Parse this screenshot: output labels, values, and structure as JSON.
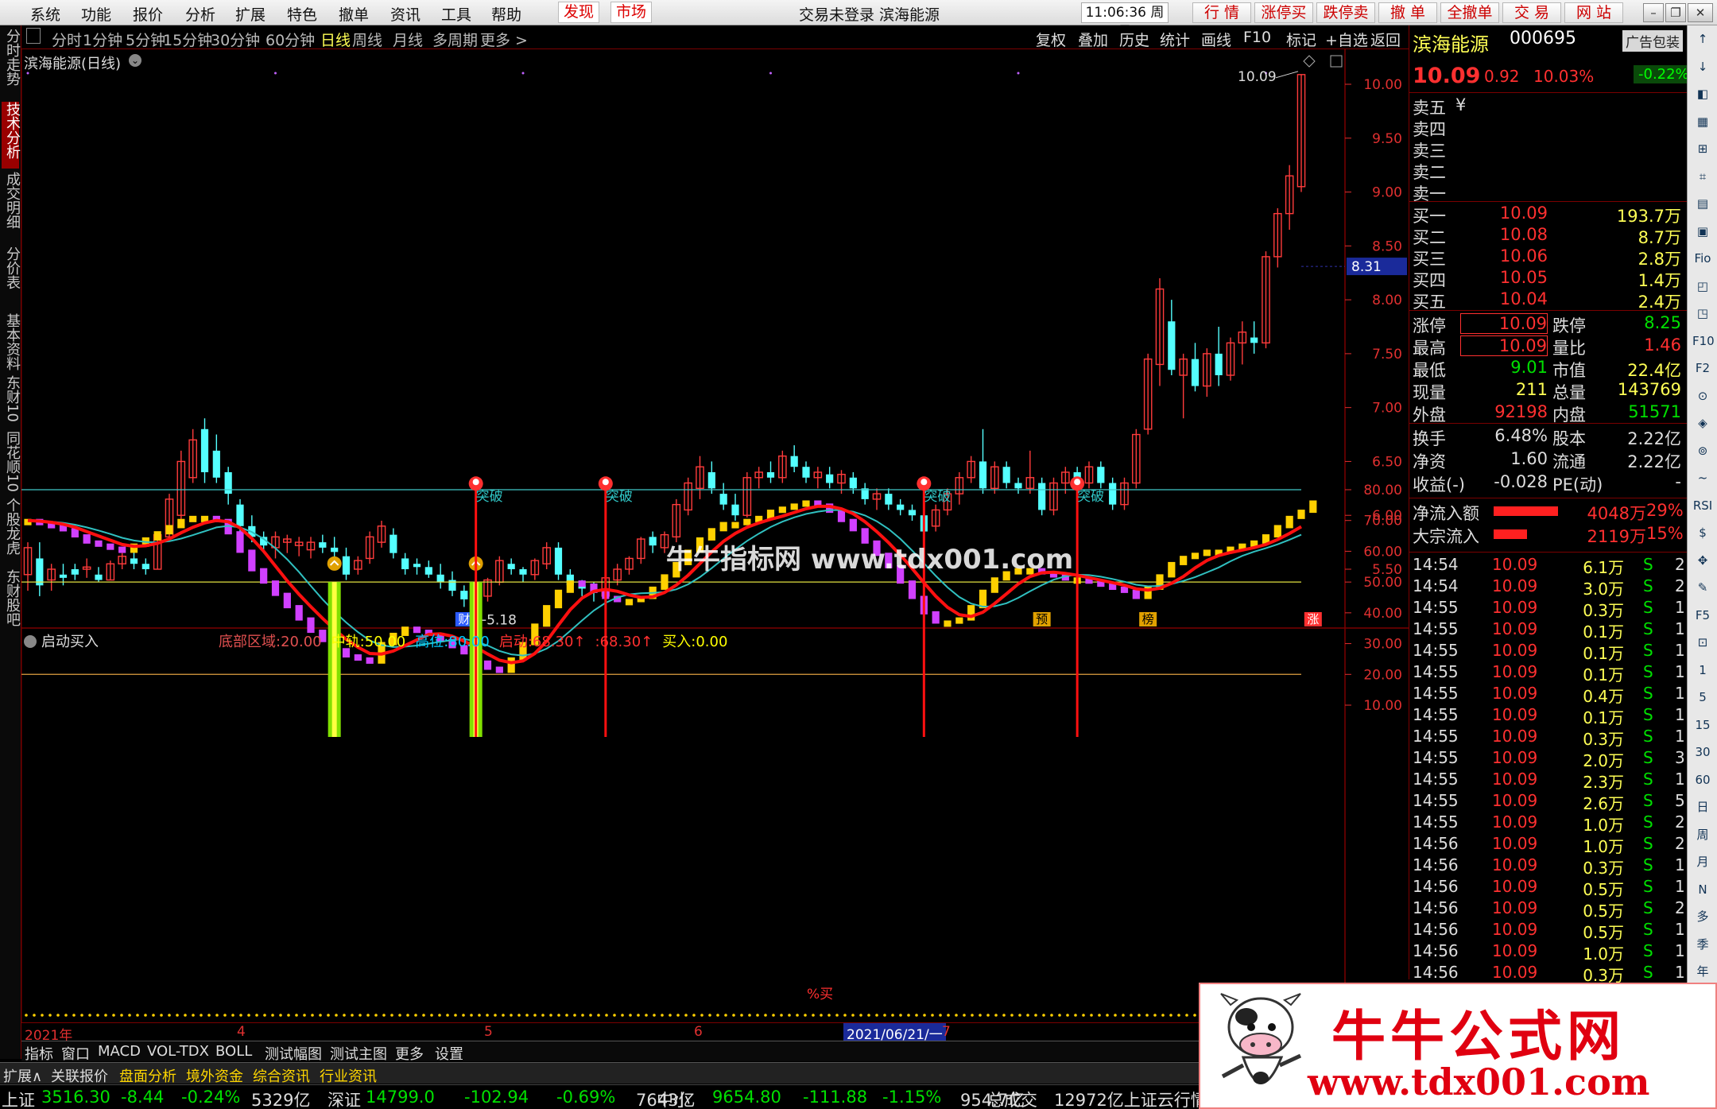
{
  "menu": {
    "items": [
      "系统",
      "功能",
      "报价",
      "分析",
      "扩展",
      "特色",
      "撤单",
      "资讯",
      "工具",
      "帮助"
    ],
    "discover": "发现",
    "market": "市场",
    "title": "交易未登录  滨海能源",
    "time": "11:06:36 周日",
    "quick": [
      "行 情",
      "涨停买",
      "跌停卖",
      "撤 单",
      "全撤单",
      "交 易",
      "网 站"
    ]
  },
  "left_tabs": [
    "分时走势",
    "技术分析",
    "成交明细",
    "分价表",
    "基本资料",
    "东财10",
    "同花顺10",
    "个股龙虎",
    "东财股吧"
  ],
  "period_bar": {
    "items": [
      "分时",
      "1分钟",
      "5分钟",
      "15分钟",
      "30分钟",
      "60分钟",
      "日线",
      "周线",
      "月线",
      "多周期",
      "更多 >"
    ],
    "selected": "日线",
    "tools": [
      "复权",
      "叠加",
      "历史",
      "统计",
      "画线",
      "F10",
      "标记",
      "+自选",
      "返回"
    ]
  },
  "main_chart": {
    "title": "滨海能源(日线)",
    "y_ticks": [
      "10.00",
      "9.50",
      "9.00",
      "8.50",
      "8.00",
      "7.50",
      "7.00",
      "6.50",
      "6.00",
      "5.50"
    ],
    "current_tag": "8.31",
    "high_label": "10.09",
    "low_label": "5.18",
    "markers": [
      "财",
      "预",
      "榜",
      "涨"
    ]
  },
  "watermark": "牛牛指标网  www.tdx001.com",
  "indicator": {
    "name": "启动买入",
    "params": [
      {
        "label": "底部区域:",
        "value": "20.00",
        "color": "#e05050"
      },
      {
        "label": "中轨:",
        "value": "50.00",
        "color": "#ffff00"
      },
      {
        "label": "高位:",
        "value": "80.00",
        "color": "#00c8ff"
      },
      {
        "label": "启动:",
        "value": "68.30↑",
        "color": "#ff3030"
      },
      {
        "label": ":",
        "value": "68.30↑",
        "color": "#ff3030"
      },
      {
        "label": "买入:",
        "value": "0.00",
        "color": "#ffff00"
      }
    ],
    "y_ticks": [
      "80.00",
      "70.00",
      "60.00",
      "50.00",
      "40.00",
      "30.00",
      "20.00",
      "10.00"
    ],
    "signal": "突破",
    "buy_text": "%买"
  },
  "chart_data": {
    "type": "candlestick",
    "title": "滨海能源(日线)",
    "ylim": [
      5.0,
      10.2
    ],
    "candles": [
      [
        5.45,
        5.75,
        5.3,
        5.7
      ],
      [
        5.6,
        5.75,
        5.25,
        5.35
      ],
      [
        5.4,
        5.55,
        5.3,
        5.5
      ],
      [
        5.45,
        5.55,
        5.35,
        5.42
      ],
      [
        5.5,
        5.55,
        5.4,
        5.45
      ],
      [
        5.5,
        5.6,
        5.42,
        5.52
      ],
      [
        5.45,
        5.52,
        5.38,
        5.4
      ],
      [
        5.4,
        5.58,
        5.4,
        5.55
      ],
      [
        5.55,
        5.65,
        5.5,
        5.62
      ],
      [
        5.6,
        5.72,
        5.5,
        5.55
      ],
      [
        5.55,
        5.6,
        5.45,
        5.5
      ],
      [
        5.5,
        5.85,
        5.5,
        5.82
      ],
      [
        5.8,
        6.2,
        5.8,
        6.15
      ],
      [
        6.0,
        6.6,
        5.9,
        6.5
      ],
      [
        6.35,
        6.8,
        6.3,
        6.7
      ],
      [
        6.8,
        6.9,
        6.3,
        6.4
      ],
      [
        6.6,
        6.75,
        6.3,
        6.35
      ],
      [
        6.4,
        6.45,
        6.1,
        6.2
      ],
      [
        6.1,
        6.15,
        5.85,
        5.9
      ],
      [
        5.9,
        6.0,
        5.75,
        5.8
      ],
      [
        5.8,
        5.85,
        5.65,
        5.72
      ],
      [
        5.7,
        5.85,
        5.6,
        5.8
      ],
      [
        5.75,
        5.82,
        5.65,
        5.78
      ],
      [
        5.72,
        5.8,
        5.62,
        5.75
      ],
      [
        5.68,
        5.8,
        5.6,
        5.75
      ],
      [
        5.75,
        5.82,
        5.65,
        5.7
      ],
      [
        5.7,
        5.8,
        5.6,
        5.66
      ],
      [
        5.62,
        5.7,
        5.4,
        5.45
      ],
      [
        5.5,
        5.62,
        5.45,
        5.58
      ],
      [
        5.6,
        5.85,
        5.55,
        5.8
      ],
      [
        5.75,
        5.95,
        5.7,
        5.9
      ],
      [
        5.82,
        5.88,
        5.6,
        5.65
      ],
      [
        5.6,
        5.65,
        5.45,
        5.5
      ],
      [
        5.55,
        5.6,
        5.45,
        5.52
      ],
      [
        5.52,
        5.58,
        5.42,
        5.45
      ],
      [
        5.45,
        5.55,
        5.32,
        5.38
      ],
      [
        5.4,
        5.48,
        5.25,
        5.3
      ],
      [
        5.3,
        5.35,
        5.15,
        5.22
      ],
      [
        5.2,
        5.3,
        5.12,
        5.25
      ],
      [
        5.25,
        5.42,
        5.2,
        5.4
      ],
      [
        5.38,
        5.62,
        5.35,
        5.58
      ],
      [
        5.55,
        5.6,
        5.45,
        5.5
      ],
      [
        5.5,
        5.52,
        5.38,
        5.45
      ],
      [
        5.45,
        5.6,
        5.4,
        5.58
      ],
      [
        5.55,
        5.75,
        5.5,
        5.7
      ],
      [
        5.7,
        5.75,
        5.4,
        5.45
      ],
      [
        5.45,
        5.5,
        5.3,
        5.35
      ],
      [
        5.35,
        5.4,
        5.25,
        5.32
      ],
      [
        5.3,
        5.38,
        5.2,
        5.28
      ],
      [
        5.25,
        5.45,
        5.22,
        5.42
      ],
      [
        5.4,
        5.55,
        5.35,
        5.5
      ],
      [
        5.5,
        5.62,
        5.45,
        5.6
      ],
      [
        5.6,
        5.8,
        5.55,
        5.78
      ],
      [
        5.8,
        5.85,
        5.65,
        5.72
      ],
      [
        5.7,
        5.85,
        5.65,
        5.82
      ],
      [
        5.8,
        6.15,
        5.75,
        6.1
      ],
      [
        6.05,
        6.35,
        6.0,
        6.3
      ],
      [
        6.25,
        6.55,
        6.15,
        6.45
      ],
      [
        6.4,
        6.5,
        6.2,
        6.25
      ],
      [
        6.2,
        6.3,
        6.05,
        6.1
      ],
      [
        6.1,
        6.2,
        5.95,
        6.0
      ],
      [
        6.0,
        6.4,
        5.98,
        6.35
      ],
      [
        6.35,
        6.45,
        6.25,
        6.4
      ],
      [
        6.4,
        6.5,
        6.3,
        6.35
      ],
      [
        6.35,
        6.6,
        6.3,
        6.55
      ],
      [
        6.55,
        6.65,
        6.4,
        6.45
      ],
      [
        6.45,
        6.5,
        6.3,
        6.35
      ],
      [
        6.35,
        6.45,
        6.25,
        6.4
      ],
      [
        6.38,
        6.45,
        6.25,
        6.3
      ],
      [
        6.3,
        6.42,
        6.2,
        6.38
      ],
      [
        6.35,
        6.4,
        6.2,
        6.25
      ],
      [
        6.25,
        6.3,
        6.1,
        6.15
      ],
      [
        6.15,
        6.25,
        6.05,
        6.2
      ],
      [
        6.2,
        6.25,
        6.05,
        6.1
      ],
      [
        6.1,
        6.15,
        6.0,
        6.05
      ],
      [
        6.05,
        6.1,
        5.95,
        6.0
      ],
      [
        6.0,
        6.05,
        5.75,
        5.85
      ],
      [
        5.9,
        6.1,
        5.85,
        6.05
      ],
      [
        6.05,
        6.25,
        6.0,
        6.2
      ],
      [
        6.2,
        6.4,
        6.1,
        6.35
      ],
      [
        6.35,
        6.55,
        6.3,
        6.5
      ],
      [
        6.5,
        6.8,
        6.2,
        6.25
      ],
      [
        6.25,
        6.5,
        6.2,
        6.45
      ],
      [
        6.45,
        6.5,
        6.25,
        6.3
      ],
      [
        6.3,
        6.35,
        6.2,
        6.25
      ],
      [
        6.25,
        6.6,
        6.2,
        6.35
      ],
      [
        6.3,
        6.35,
        6.0,
        6.05
      ],
      [
        6.05,
        6.35,
        6.0,
        6.3
      ],
      [
        6.3,
        6.45,
        6.2,
        6.4
      ],
      [
        6.4,
        6.45,
        6.25,
        6.3
      ],
      [
        6.3,
        6.5,
        6.25,
        6.45
      ],
      [
        6.45,
        6.5,
        6.25,
        6.3
      ],
      [
        6.3,
        6.35,
        6.05,
        6.1
      ],
      [
        6.1,
        6.35,
        6.05,
        6.3
      ],
      [
        6.3,
        6.8,
        6.25,
        6.75
      ],
      [
        6.8,
        7.5,
        6.75,
        7.45
      ],
      [
        7.4,
        8.2,
        7.2,
        8.1
      ],
      [
        7.8,
        8.0,
        7.3,
        7.35
      ],
      [
        7.3,
        7.5,
        6.9,
        7.45
      ],
      [
        7.45,
        7.6,
        7.15,
        7.2
      ],
      [
        7.2,
        7.55,
        7.1,
        7.5
      ],
      [
        7.5,
        7.75,
        7.2,
        7.3
      ],
      [
        7.3,
        7.65,
        7.25,
        7.6
      ],
      [
        7.6,
        7.8,
        7.4,
        7.7
      ],
      [
        7.65,
        7.8,
        7.5,
        7.6
      ],
      [
        7.6,
        8.45,
        7.55,
        8.4
      ],
      [
        8.4,
        8.85,
        8.3,
        8.8
      ],
      [
        8.8,
        9.25,
        8.65,
        9.15
      ],
      [
        9.05,
        10.09,
        9.0,
        10.09
      ]
    ],
    "indicator_series": {
      "ylim": [
        10,
        85
      ],
      "levels": [
        20,
        50,
        80
      ],
      "signals": [
        "突破",
        "突破",
        "突破",
        "突破"
      ]
    }
  },
  "quote": {
    "name": "滨海能源",
    "code": "000695",
    "ad": "广告包装",
    "price": "10.09",
    "change": "0.92",
    "pct": "10.03%",
    "pct2": "-0.22%",
    "asks": [
      {
        "label": "卖五",
        "price": "",
        "vol": ""
      },
      {
        "label": "卖四",
        "price": "",
        "vol": ""
      },
      {
        "label": "卖三",
        "price": "",
        "vol": ""
      },
      {
        "label": "卖二",
        "price": "",
        "vol": ""
      },
      {
        "label": "卖一",
        "price": "",
        "vol": ""
      }
    ],
    "bids": [
      {
        "label": "买一",
        "price": "10.09",
        "vol": "193.7万"
      },
      {
        "label": "买二",
        "price": "10.08",
        "vol": "8.7万"
      },
      {
        "label": "买三",
        "price": "10.06",
        "vol": "2.8万"
      },
      {
        "label": "买四",
        "price": "10.05",
        "vol": "1.4万"
      },
      {
        "label": "买五",
        "price": "10.04",
        "vol": "2.4万"
      }
    ],
    "stats": [
      [
        "涨停",
        "10.09",
        "跌停",
        "8.25"
      ],
      [
        "最高",
        "10.09",
        "量比",
        "1.46"
      ],
      [
        "最低",
        "9.01",
        "市值",
        "22.4亿"
      ],
      [
        "现量",
        "211",
        "总量",
        "143769"
      ],
      [
        "外盘",
        "92198",
        "内盘",
        "51571"
      ]
    ],
    "stats2": [
      [
        "换手",
        "6.48%",
        "股本",
        "2.22亿"
      ],
      [
        "净资",
        "1.60",
        "流通",
        "2.22亿"
      ],
      [
        "收益(-)",
        "-0.028",
        "PE(动)",
        "-"
      ]
    ],
    "flows": [
      {
        "label": "净流入额",
        "value": "4048万",
        "pct": "29%",
        "bar": 0.29
      },
      {
        "label": "大宗流入",
        "value": "2119万",
        "pct": "15%",
        "bar": 0.15
      }
    ],
    "ticks": [
      [
        "14:54",
        "10.09",
        "6.1万",
        "S",
        "2"
      ],
      [
        "14:54",
        "10.09",
        "3.0万",
        "S",
        "2"
      ],
      [
        "14:55",
        "10.09",
        "0.3万",
        "S",
        "1"
      ],
      [
        "14:55",
        "10.09",
        "0.1万",
        "S",
        "1"
      ],
      [
        "14:55",
        "10.09",
        "0.1万",
        "S",
        "1"
      ],
      [
        "14:55",
        "10.09",
        "0.1万",
        "S",
        "1"
      ],
      [
        "14:55",
        "10.09",
        "0.4万",
        "S",
        "1"
      ],
      [
        "14:55",
        "10.09",
        "0.1万",
        "S",
        "1"
      ],
      [
        "14:55",
        "10.09",
        "0.3万",
        "S",
        "1"
      ],
      [
        "14:55",
        "10.09",
        "2.0万",
        "S",
        "3"
      ],
      [
        "14:55",
        "10.09",
        "2.3万",
        "S",
        "1"
      ],
      [
        "14:55",
        "10.09",
        "2.6万",
        "S",
        "5"
      ],
      [
        "14:55",
        "10.09",
        "1.0万",
        "S",
        "2"
      ],
      [
        "14:56",
        "10.09",
        "1.0万",
        "S",
        "2"
      ],
      [
        "14:56",
        "10.09",
        "0.3万",
        "S",
        "1"
      ],
      [
        "14:56",
        "10.09",
        "0.5万",
        "S",
        "1"
      ],
      [
        "14:56",
        "10.09",
        "0.5万",
        "S",
        "2"
      ],
      [
        "14:56",
        "10.09",
        "0.5万",
        "S",
        "1"
      ],
      [
        "14:56",
        "10.09",
        "1.0万",
        "S",
        "1"
      ],
      [
        "14:56",
        "10.09",
        "0.3万",
        "S",
        "1"
      ]
    ]
  },
  "date_bar": {
    "start": "2021年",
    "m4": "4",
    "m5": "5",
    "m6": "6",
    "m7": "7",
    "cursor": "2021/06/21/一"
  },
  "bottom_tabs": [
    "指标",
    "窗口",
    "MACD",
    "VOL-TDX",
    "BOLL",
    "测试幅图",
    "测试主图",
    "更多",
    "设置"
  ],
  "function_tabs": [
    {
      "label": "扩展∧",
      "color": "#ddd"
    },
    {
      "label": "关联报价",
      "color": "#ddd"
    },
    {
      "label": "盘面分析",
      "color": "#ffd700"
    },
    {
      "label": "境外资金",
      "color": "#ffd700"
    },
    {
      "label": "综合资讯",
      "color": "#ffd700"
    },
    {
      "label": "行业资讯",
      "color": "#ffd700"
    }
  ],
  "ticker": [
    {
      "t": "上证",
      "c": "#ddd"
    },
    {
      "t": "3516.30",
      "c": "#00e000"
    },
    {
      "t": "-8.44",
      "c": "#00e000"
    },
    {
      "t": "-0.24%",
      "c": "#00e000"
    },
    {
      "t": "5329亿",
      "c": "#ddd"
    },
    {
      "t": "深证",
      "c": "#ddd"
    },
    {
      "t": "14799.0",
      "c": "#00e000"
    },
    {
      "t": "-102.94",
      "c": "#00e000"
    },
    {
      "t": "-0.69%",
      "c": "#00e000"
    },
    {
      "t": "7643亿",
      "c": "#ddd"
    },
    {
      "t": "中小",
      "c": "#ddd"
    },
    {
      "t": "9654.80",
      "c": "#00e000"
    },
    {
      "t": "-111.88",
      "c": "#00e000"
    },
    {
      "t": "-1.15%",
      "c": "#00e000"
    },
    {
      "t": "954.7亿",
      "c": "#ddd"
    },
    {
      "t": "总成交",
      "c": "#ddd"
    },
    {
      "t": "12972亿上证云行情",
      "c": "#ddd"
    }
  ],
  "ad": {
    "title": "牛牛公式网",
    "url": "www.tdx001.com"
  },
  "right_tools": [
    "↑",
    "↓",
    "◧",
    "▦",
    "⊞",
    "⌗",
    "▤",
    "▣",
    "Fio",
    "◰",
    "◳",
    "F10",
    "F2",
    "⊙",
    "◈",
    "⊚",
    "~",
    "RSI",
    "$",
    "✥",
    "✎",
    "F5",
    "⊡",
    "1",
    "5",
    "15",
    "30",
    "60",
    "日",
    "周",
    "月",
    "N",
    "多",
    "季",
    "年"
  ]
}
